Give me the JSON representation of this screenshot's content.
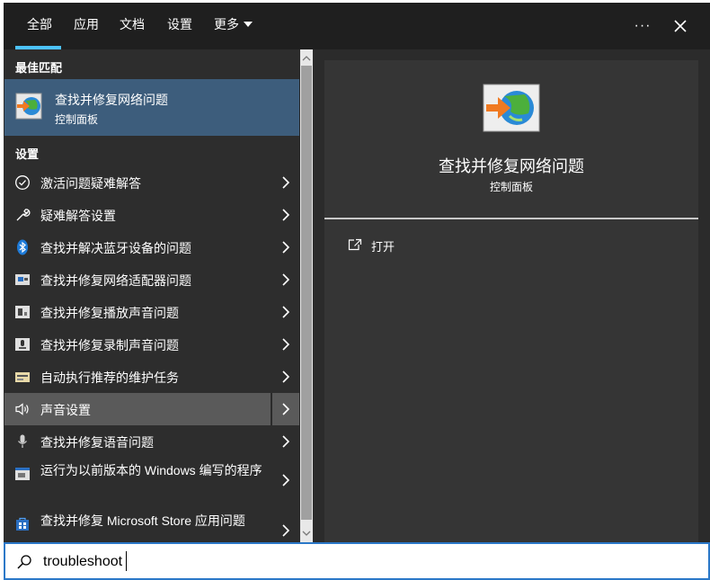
{
  "tabs": [
    {
      "label": "全部",
      "active": true
    },
    {
      "label": "应用"
    },
    {
      "label": "文档"
    },
    {
      "label": "设置"
    },
    {
      "label": "更多"
    }
  ],
  "window_controls": {
    "more_options": "···",
    "close": "✕"
  },
  "best_match": {
    "heading": "最佳匹配",
    "title": "查找并修复网络问题",
    "subtitle": "控制面板",
    "icon": "network-troubleshooter-icon"
  },
  "settings_section": {
    "heading": "设置",
    "items": [
      {
        "label": "激活问题疑难解答",
        "icon": "check-circle-icon"
      },
      {
        "label": "疑难解答设置",
        "icon": "wrench-icon"
      },
      {
        "label": "查找并解决蓝牙设备的问题",
        "icon": "bluetooth-icon"
      },
      {
        "label": "查找并修复网络适配器问题",
        "icon": "network-adapter-icon"
      },
      {
        "label": "查找并修复播放声音问题",
        "icon": "speaker-device-icon"
      },
      {
        "label": "查找并修复录制声音问题",
        "icon": "microphone-device-icon"
      },
      {
        "label": "自动执行推荐的维护任务",
        "icon": "maintenance-icon"
      },
      {
        "label": "声音设置",
        "icon": "volume-icon",
        "selected": true
      },
      {
        "label": "查找并修复语音问题",
        "icon": "microphone-icon"
      },
      {
        "label": "运行为以前版本的 Windows 编写的程序",
        "icon": "compatibility-icon"
      },
      {
        "label": "查找并修复 Microsoft Store 应用问题",
        "icon": "store-icon"
      }
    ]
  },
  "preview": {
    "title": "查找并修复网络问题",
    "subtitle": "控制面板",
    "actions": [
      {
        "label": "打开",
        "icon": "open-icon"
      }
    ]
  },
  "search": {
    "value": "troubleshoot",
    "placeholder": ""
  },
  "colors": {
    "accent": "#4cc2ff",
    "best_match_bg": "#3d5d7c",
    "selected_bg": "#5a5a5a",
    "search_border": "#2b78c8"
  }
}
